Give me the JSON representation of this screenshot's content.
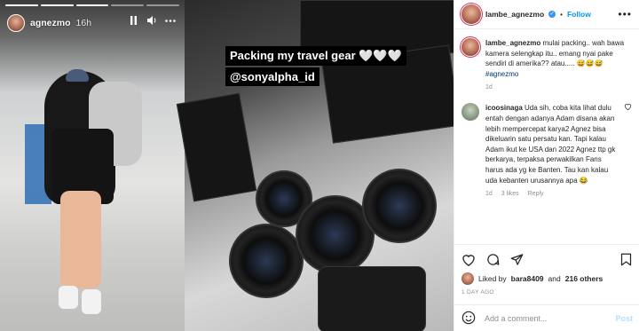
{
  "story": {
    "username": "agnezmo",
    "time": "16h",
    "segments": 5,
    "overlay_text": "Packing my travel gear 🤍🤍🤍",
    "overlay_tag": "@sonyalpha_id"
  },
  "header": {
    "username": "lambe_agnezmo",
    "follow_label": "Follow",
    "more_label": "•••"
  },
  "caption": {
    "username": "lambe_agnezmo",
    "text": "mulai packing.. wah bawa kamera selengkap itu.. emang nyai pake sendiri di amerika?? atau..... 😅😅😅",
    "hashtag": "#agnezmo",
    "age": "1d"
  },
  "comment": {
    "username": "icoosinaga",
    "text": "Uda sih, coba kita lihat dulu entah dengan adanya Adam disana akan lebih mempercepat karya2 Agnez bisa dikeluarin satu persatu kan. Tapi kalau Adam ikut ke USA dan 2022 Agnez ttp gk berkarya, terpaksa perwakilkan Fans harus ada yg ke Banten. Tau kan kalau uda kebanten urusannya apa 😂",
    "age": "1d",
    "likes": "3 likes",
    "reply": "Reply"
  },
  "likes": {
    "prefix": "Liked by",
    "user": "bara8409",
    "and": "and",
    "others": "216 others"
  },
  "posted": "1 DAY AGO",
  "add_comment": {
    "placeholder": "Add a comment...",
    "post_label": "Post"
  },
  "colors": {
    "accent": "#0095f6",
    "post_disabled": "#b2dffc",
    "muted": "#8e8e8e"
  }
}
